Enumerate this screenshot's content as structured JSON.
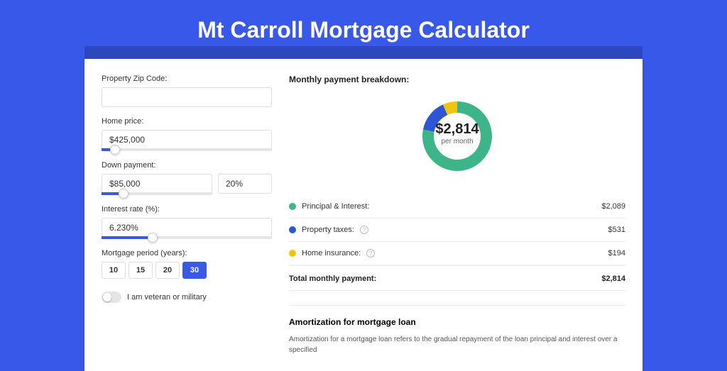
{
  "title": "Mt Carroll Mortgage Calculator",
  "form": {
    "zip": {
      "label": "Property Zip Code:",
      "value": ""
    },
    "price": {
      "label": "Home price:",
      "value": "$425,000",
      "slider_pct": 8
    },
    "down": {
      "label": "Down payment:",
      "amount": "$85,000",
      "pct": "20%",
      "slider_pct": 20
    },
    "rate": {
      "label": "Interest rate (%):",
      "value": "6.230%",
      "slider_pct": 30
    },
    "period": {
      "label": "Mortgage period (years):",
      "options": [
        "10",
        "15",
        "20",
        "30"
      ],
      "active": "30"
    },
    "veteran": {
      "label": "I am veteran or military"
    }
  },
  "breakdown": {
    "title": "Monthly payment breakdown:",
    "amount": "$2,814",
    "subtext": "per month",
    "items": [
      {
        "label": "Principal & Interest:",
        "value": "$2,089",
        "color": "#3eb489",
        "info": false
      },
      {
        "label": "Property taxes:",
        "value": "$531",
        "color": "#2c56d4",
        "info": true
      },
      {
        "label": "Home insurance:",
        "value": "$194",
        "color": "#f1c40f",
        "info": true
      }
    ],
    "total": {
      "label": "Total monthly payment:",
      "value": "$2,814"
    }
  },
  "amort": {
    "title": "Amortization for mortgage loan",
    "text": "Amortization for a mortgage loan refers to the gradual repayment of the loan principal and interest over a specified"
  },
  "chart_data": {
    "type": "pie",
    "title": "Monthly payment breakdown",
    "categories": [
      "Principal & Interest",
      "Property taxes",
      "Home insurance"
    ],
    "values": [
      2089,
      531,
      194
    ],
    "colors": [
      "#3eb489",
      "#2c56d4",
      "#f1c40f"
    ],
    "total": 2814
  }
}
